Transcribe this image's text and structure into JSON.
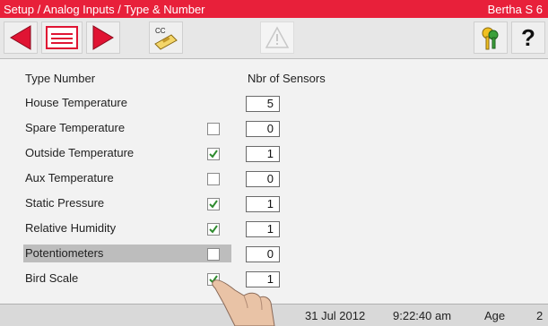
{
  "window": {
    "title": "Setup / Analog Inputs / Type & Number",
    "device": "Bertha S 6"
  },
  "toolbar": {
    "prev_icon": "arrow-left-icon",
    "list_icon": "list-icon",
    "next_icon": "arrow-right-icon",
    "copy_label": "CC",
    "warning_icon": "warning-icon",
    "keys_icon": "keys-icon",
    "help_label": "?"
  },
  "table": {
    "col_type": "Type  Number",
    "col_sensors": "Nbr of Sensors",
    "rows": [
      {
        "label": "House Temperature",
        "checkbox": null,
        "sensors": "5"
      },
      {
        "label": "Spare Temperature",
        "checkbox": false,
        "sensors": "0"
      },
      {
        "label": "Outside Temperature",
        "checkbox": true,
        "sensors": "1"
      },
      {
        "label": "Aux Temperature",
        "checkbox": false,
        "sensors": "0"
      },
      {
        "label": "Static Pressure",
        "checkbox": true,
        "sensors": "1"
      },
      {
        "label": "Relative Humidity",
        "checkbox": true,
        "sensors": "1"
      },
      {
        "label": "Potentiometers",
        "checkbox": false,
        "sensors": "0",
        "selected": true
      },
      {
        "label": "Bird Scale",
        "checkbox": true,
        "sensors": "1"
      }
    ]
  },
  "status": {
    "date": "31 Jul 2012",
    "time": "9:22:40 am",
    "age_label": "Age",
    "age_value": "2"
  },
  "colors": {
    "title_bar": "#e8203a",
    "arrow_red": "#e01433",
    "check_green": "#2e8b2e"
  }
}
